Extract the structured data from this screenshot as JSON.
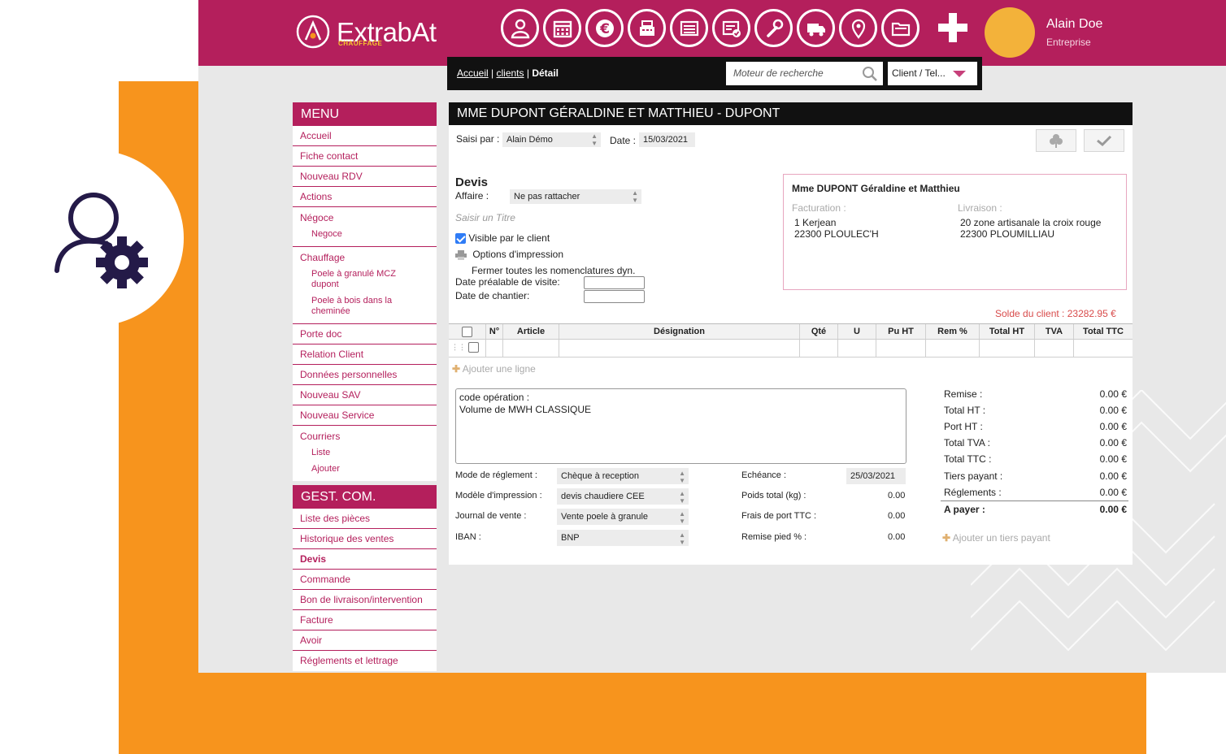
{
  "brand": {
    "name": "ExtrabAt",
    "sub": "CHAUFFAGE"
  },
  "nav_icons": [
    "client-icon",
    "calendar-icon",
    "euro-icon",
    "cash-register-icon",
    "sheet-icon",
    "checklist-icon",
    "wrench-icon",
    "truck-icon",
    "location-pin-icon",
    "folders-icon"
  ],
  "user": {
    "name": "Alain Doe",
    "role": "Entreprise"
  },
  "breadcrumb": {
    "home": "Accueil",
    "sep1": "|",
    "clients": "clients",
    "sep2": "|",
    "current": "Détail"
  },
  "search": {
    "placeholder": "Moteur de recherche",
    "scope": "Client / Tel..."
  },
  "menu": {
    "title": "MENU",
    "accueil": "Accueil",
    "fiche": "Fiche contact",
    "rdv": "Nouveau RDV",
    "actions": "Actions",
    "negoce": "Négoce",
    "negoce_sub": "Negoce",
    "chauffage": "Chauffage",
    "chauffage_sub1": "Poele à granulé MCZ dupont",
    "chauffage_sub2": "Poele à bois dans la cheminée",
    "porte_doc": "Porte doc",
    "relation": "Relation Client",
    "donnees": "Données personnelles",
    "sav": "Nouveau SAV",
    "service": "Nouveau Service",
    "courriers": "Courriers",
    "courriers_sub1": "Liste",
    "courriers_sub2": "Ajouter"
  },
  "gestcom": {
    "title": "GEST. COM.",
    "items": [
      "Liste des pièces",
      "Historique des ventes",
      "Devis",
      "Commande",
      "Bon de livraison/intervention",
      "Facture",
      "Avoir",
      "Réglements et lettrage"
    ]
  },
  "doc": {
    "title": "MME DUPONT GÉRALDINE ET MATTHIEU - DUPONT",
    "saisi_label": "Saisi par :",
    "saisi_value": "Alain Démo",
    "date_label": "Date :",
    "date_value": "15/03/2021",
    "type": "Devis",
    "affaire_label": "Affaire :",
    "affaire_value": "Ne pas rattacher",
    "titre_placeholder": "Saisir un Titre",
    "visible_label": "Visible par le client",
    "options_label": "Options d'impression",
    "fermer_label": "Fermer toutes les nomenclatures dyn.",
    "visite_label": "Date préalable de visite:",
    "chantier_label": "Date de chantier:",
    "solde": "Solde du client : 23282.95 €"
  },
  "address": {
    "name": "Mme DUPONT Géraldine et Matthieu",
    "fact_label": "Facturation :",
    "fact_line1": "1 Kerjean",
    "fact_line2": "22300 PLOULEC'H",
    "liv_label": "Livraison :",
    "liv_line1": "20 zone artisanale la croix rouge",
    "liv_line2": "22300 PLOUMILLIAU"
  },
  "table": {
    "headers": [
      "N°",
      "Article",
      "Désignation",
      "Qté",
      "U",
      "Pu HT",
      "Rem %",
      "Total HT",
      "TVA",
      "Total TTC"
    ],
    "add_line": "Ajouter une ligne"
  },
  "notes": {
    "line1": "code opération :",
    "line2": "Volume de MWH CLASSIQUE"
  },
  "payment": {
    "mode_label": "Mode de réglement :",
    "mode_value": "Chèque à reception",
    "modele_label": "Modèle d'impression :",
    "modele_value": "devis chaudiere CEE",
    "journal_label": "Journal de vente :",
    "journal_value": "Vente poele à granule",
    "iban_label": "IBAN :",
    "iban_value": "BNP",
    "echeance_label": "Echéance :",
    "echeance_value": "25/03/2021",
    "poids_label": "Poids total (kg) :",
    "poids_value": "0.00",
    "frais_label": "Frais de port TTC :",
    "frais_value": "0.00",
    "remise_pied_label": "Remise pied % :",
    "remise_pied_value": "0.00"
  },
  "totals": {
    "rows": [
      {
        "label": "Remise :",
        "value": "0.00 €"
      },
      {
        "label": "Total HT :",
        "value": "0.00 €"
      },
      {
        "label": "Port HT :",
        "value": "0.00 €"
      },
      {
        "label": "Total TVA :",
        "value": "0.00 €"
      },
      {
        "label": "Total TTC :",
        "value": "0.00 €"
      },
      {
        "label": "Tiers payant :",
        "value": "0.00 €"
      },
      {
        "label": "Réglements :",
        "value": "0.00 €"
      }
    ],
    "apayer_label": "A payer :",
    "apayer_value": "0.00 €",
    "add_tiers": "Ajouter un tiers payant"
  },
  "colors": {
    "brand": "#b41f5c",
    "accent": "#f7941d",
    "avatar": "#f3b23a"
  }
}
